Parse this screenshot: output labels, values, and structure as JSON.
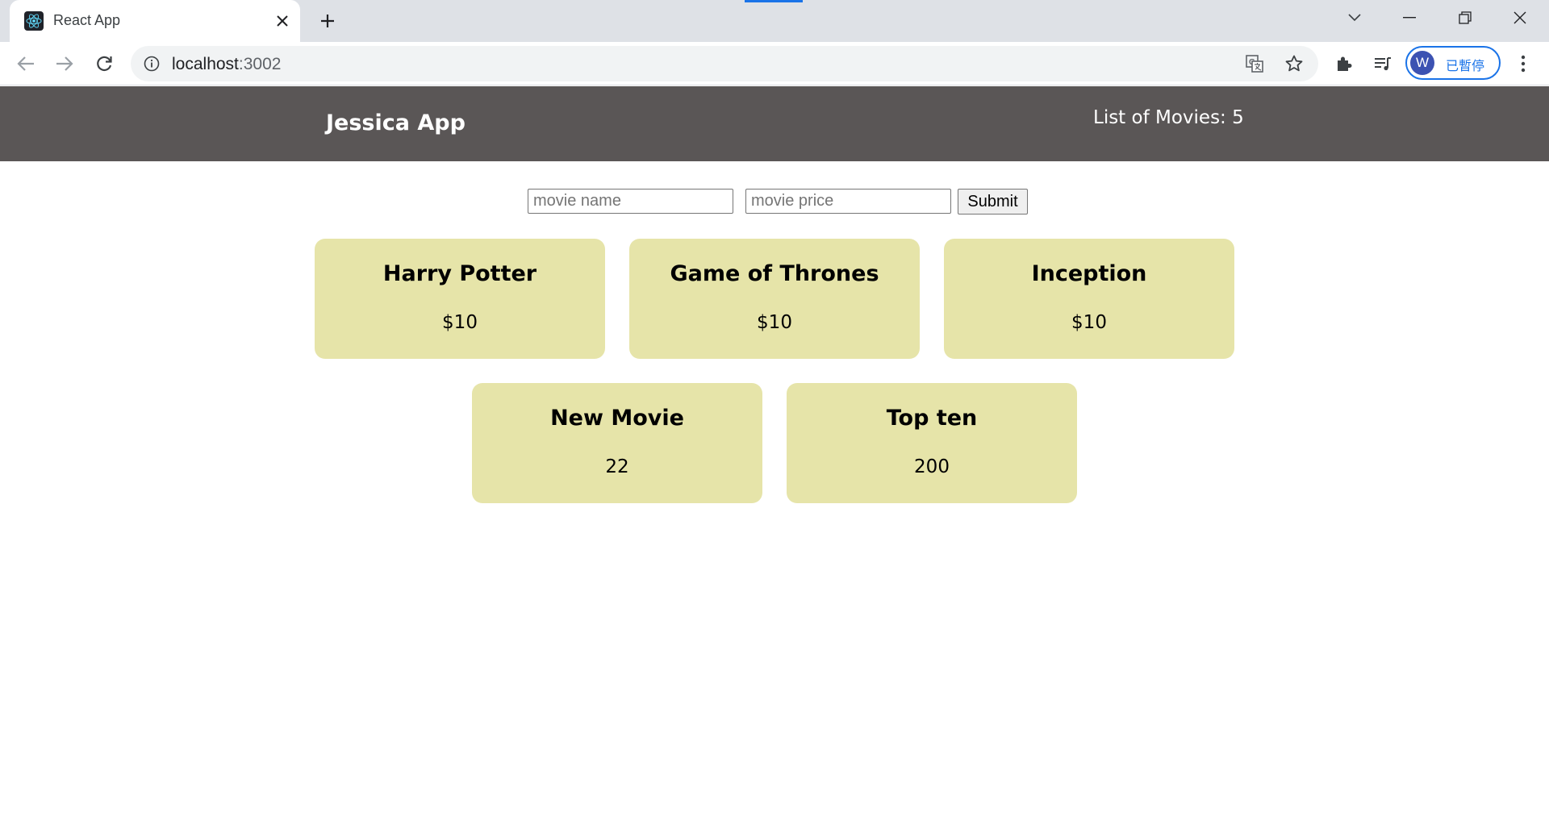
{
  "browser": {
    "tab_title": "React App",
    "url_host": "localhost",
    "url_port": ":3002",
    "profile_initial": "W",
    "profile_label": "已暫停"
  },
  "colors": {
    "header_bg": "#5a5656",
    "card_bg": "#e6e4a9",
    "accent": "#1a73e8"
  },
  "app": {
    "title": "Jessica App",
    "movie_count_label": "List of Movies: 5"
  },
  "form": {
    "name_placeholder": "movie name",
    "price_placeholder": "movie price",
    "submit_label": "Submit"
  },
  "movies": [
    {
      "name": "Harry Potter",
      "price": "$10"
    },
    {
      "name": "Game of Thrones",
      "price": "$10"
    },
    {
      "name": "Inception",
      "price": "$10"
    },
    {
      "name": "New Movie",
      "price": "22"
    },
    {
      "name": "Top ten",
      "price": "200"
    }
  ]
}
